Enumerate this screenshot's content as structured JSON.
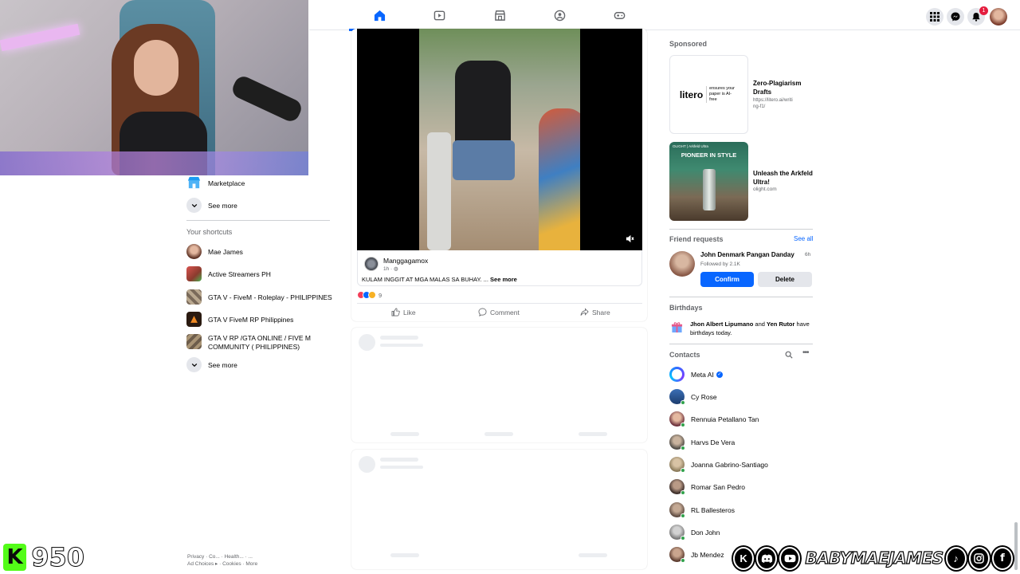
{
  "colors": {
    "accent": "#0866ff",
    "text": "#050505",
    "muted": "#65676b",
    "divider": "#e4e6eb",
    "online": "#31a24c",
    "notify": "#e41e3f"
  },
  "topnav": {
    "tabs": [
      {
        "icon": "home-icon",
        "active": true
      },
      {
        "icon": "video-icon",
        "active": false
      },
      {
        "icon": "marketplace-icon",
        "active": false
      },
      {
        "icon": "groups-icon",
        "active": false
      },
      {
        "icon": "gaming-icon",
        "active": false
      }
    ],
    "right_icons": [
      "menu-grid-icon",
      "messenger-icon",
      "notifications-icon",
      "profile-avatar"
    ],
    "notification_count": "1"
  },
  "left": {
    "marketplace_label": "Marketplace",
    "see_more_label": "See more",
    "shortcuts_title": "Your shortcuts",
    "shortcuts": [
      {
        "label": "Mae James"
      },
      {
        "label": "Active Streamers PH"
      },
      {
        "label": "GTA V - FiveM - Roleplay - PHILIPPINES"
      },
      {
        "label": "GTA V FiveM RP Philippines"
      },
      {
        "label": "GTA V RP /GTA ONLINE / FIVE M COMMUNITY ( PHILIPPINES)"
      }
    ],
    "see_more_label_2": "See more",
    "footer_line1": "Privacy · Co... · Health... · ...",
    "footer_ad_choices": "Ad Choices",
    "footer_cookies": "Cookies",
    "footer_more": "More"
  },
  "post": {
    "author": "Manggagamox",
    "time": "1h",
    "caption": "KULAM INGGIT AT MGA MALAS SA BUHAY. ...",
    "see_more": "See more",
    "reaction_count": "9",
    "like_label": "Like",
    "comment_label": "Comment",
    "share_label": "Share"
  },
  "right": {
    "sponsored_title": "Sponsored",
    "ads": [
      {
        "logo_text": "litero",
        "logo_tagline": "ensures your paper is AI-free",
        "title": "Zero-Plagiarism Drafts",
        "url": "https://litero.ai/writing-f1/"
      },
      {
        "brand": "OLIGHT",
        "product": "Arkfeld Ultra",
        "headline": "PIONEER IN STYLE",
        "title": "Unleash the Arkfeld Ultra!",
        "url": "olight.com"
      }
    ],
    "friend_requests_title": "Friend requests",
    "see_all": "See all",
    "friend_request": {
      "name": "John Denmark Pangan Danday",
      "age": "6h",
      "followed_by": "Followed by 2.1K",
      "confirm": "Confirm",
      "delete": "Delete"
    },
    "birthdays_title": "Birthdays",
    "birthday_name1": "Jhon Albert Lipumano",
    "birthday_and": "and",
    "birthday_name2": "Yen Rutor",
    "birthday_suffix": "have birthdays today.",
    "contacts_title": "Contacts",
    "contacts": [
      {
        "name": "Meta AI",
        "verified": true
      },
      {
        "name": "Cy Rose"
      },
      {
        "name": "Rennuia Petallano Tan"
      },
      {
        "name": "Harvs De Vera"
      },
      {
        "name": "Joanna Gabrino-Santiago"
      },
      {
        "name": "Romar San Pedro"
      },
      {
        "name": "RL Ballesteros"
      },
      {
        "name": "Don John"
      },
      {
        "name": "Jb Mendez"
      }
    ]
  },
  "overlay": {
    "kick_count": "950",
    "handle": "BABYMAEJAMES",
    "social_icons": [
      "kick-icon",
      "discord-icon",
      "youtube-icon",
      "tiktok-icon",
      "instagram-icon",
      "facebook-icon"
    ]
  }
}
